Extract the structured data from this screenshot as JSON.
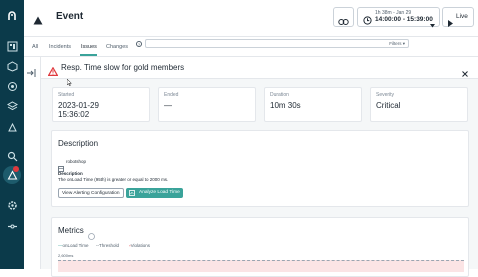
{
  "header": {
    "title": "Event",
    "time_range_top": "1h 38m - Jan 29",
    "time_range_main": "14:00:00 - 15:39:00",
    "live_label": "Live"
  },
  "tabs": [
    {
      "label": "All"
    },
    {
      "label": "Incidents"
    },
    {
      "label": "Issues"
    },
    {
      "label": "Changes"
    }
  ],
  "filters_label": "Filters",
  "help_label": "?",
  "alert": {
    "title": "Resp. Time slow for gold members"
  },
  "stats": [
    {
      "label": "Started",
      "value_line1": "2023-01-29",
      "value_line2": "15:36:02"
    },
    {
      "label": "Ended",
      "value_line1": "—",
      "value_line2": ""
    },
    {
      "label": "Duration",
      "value_line1": "10m 30s",
      "value_line2": ""
    },
    {
      "label": "Severity",
      "value_line1": "Critical",
      "value_line2": ""
    }
  ],
  "description": {
    "title": "Description",
    "entity": "robotshop",
    "subheading": "Description",
    "text": "The onLoad Time (95th) is greater or equal to 2000 ms.",
    "btn_config": "View Alerting Configuration",
    "btn_analyze": "Analyze Load Time"
  },
  "metrics": {
    "title": "Metrics",
    "legend": [
      "onLoad Time",
      "Threshold",
      "Violations"
    ],
    "y_top_label": "2,600ms"
  },
  "colors": {
    "sidebar": "#0b3a4a",
    "accent": "#3aa39a",
    "critical": "#e0393e"
  }
}
